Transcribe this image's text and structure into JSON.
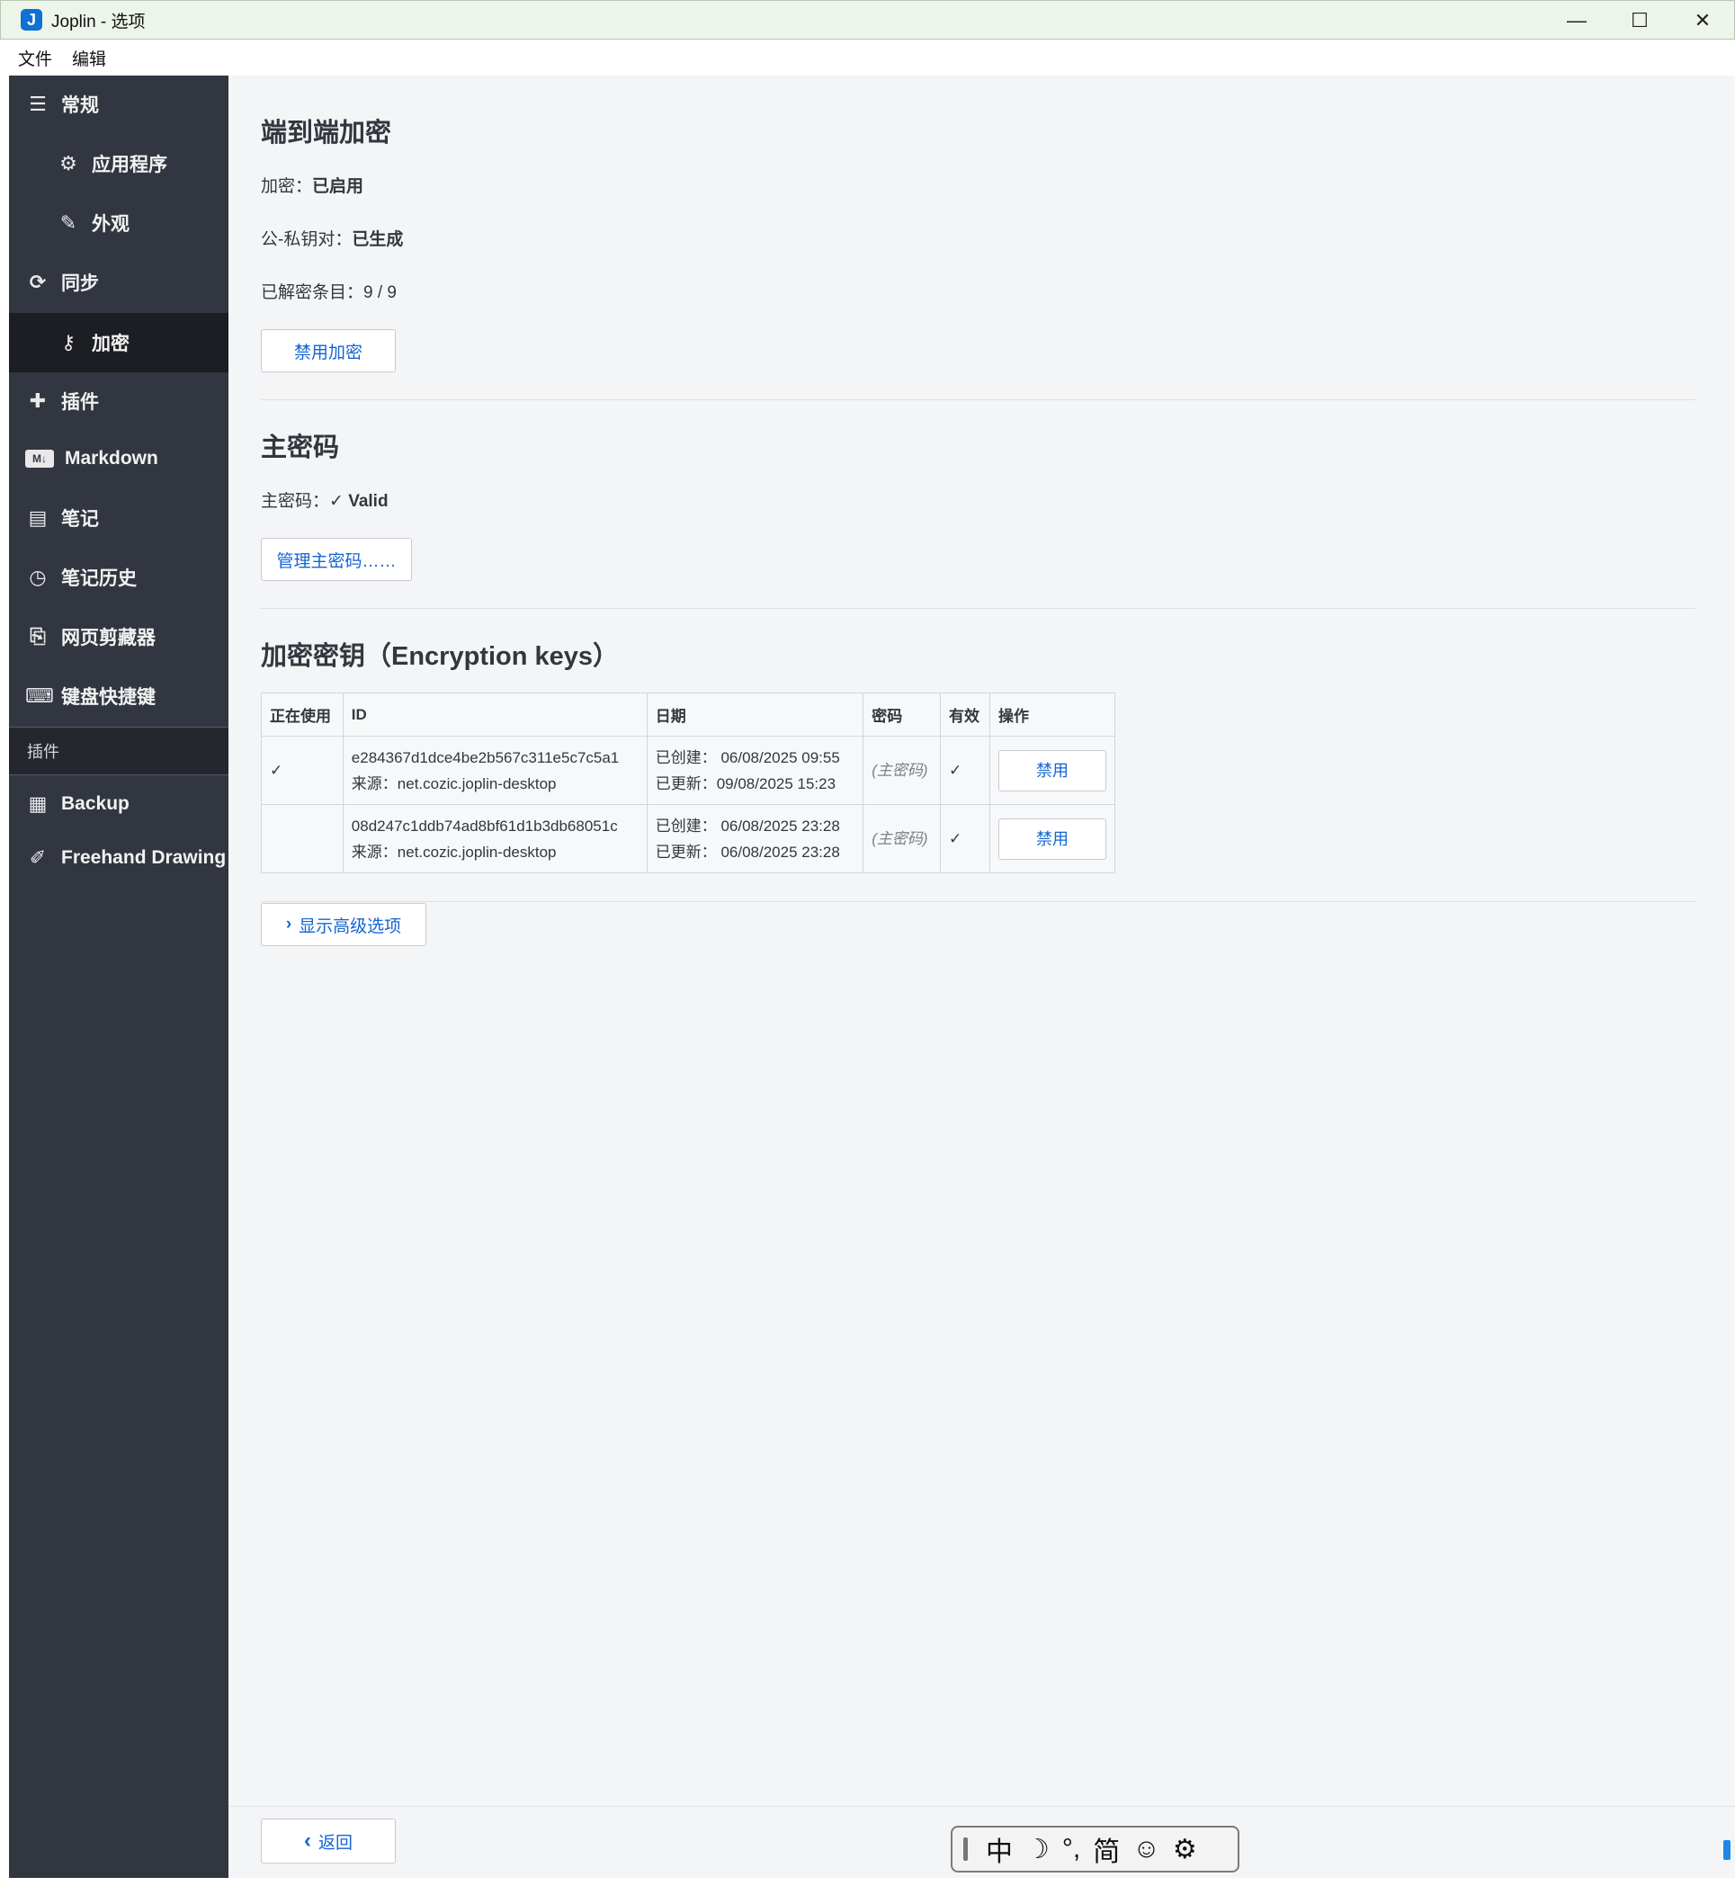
{
  "window": {
    "title": "Joplin - 选项",
    "minimize": "—",
    "maximize": "☐",
    "close": "✕"
  },
  "menu": [
    "文件",
    "编辑"
  ],
  "sidebar": {
    "items": [
      {
        "label": "常规",
        "icon": "sliders-icon"
      },
      {
        "label": "应用程序",
        "icon": "gear-icon"
      },
      {
        "label": "外观",
        "icon": "brush-icon"
      },
      {
        "label": "同步",
        "icon": "sync-icon"
      },
      {
        "label": "加密",
        "icon": "key-icon"
      },
      {
        "label": "插件",
        "icon": "puzzle-icon"
      },
      {
        "label": "Markdown",
        "icon": "markdown-icon"
      },
      {
        "label": "笔记",
        "icon": "note-icon"
      },
      {
        "label": "笔记历史",
        "icon": "history-icon"
      },
      {
        "label": "网页剪藏器",
        "icon": "clipper-icon"
      },
      {
        "label": "键盘快捷键",
        "icon": "keyboard-icon"
      }
    ],
    "section_label": "插件",
    "plugins": [
      {
        "label": "Backup",
        "icon": "archive-icon"
      },
      {
        "label": "Freehand Drawing",
        "icon": "pen-icon"
      }
    ]
  },
  "e2ee": {
    "title": "端到端加密",
    "encryption_label": "加密：",
    "encryption_value": "已启用",
    "keypair_label": "公-私钥对：",
    "keypair_value": "已生成",
    "decrypted_label": "已解密条目：",
    "decrypted_value": "9 / 9",
    "disable_button": "禁用加密"
  },
  "master_password": {
    "title": "主密码",
    "label": "主密码：",
    "value": "✓ Valid",
    "manage_button": "管理主密码……"
  },
  "keys": {
    "title": "加密密钥（Encryption keys）",
    "headers": [
      "正在使用",
      "ID",
      "日期",
      "密码",
      "有效",
      "操作"
    ],
    "rows": [
      {
        "in_use": "✓",
        "id": "e284367d1dce4be2b567c311e5c7c5a1",
        "source": "来源：net.cozic.joplin-desktop",
        "created": "已创建：  06/08/2025 09:55",
        "updated": "已更新：09/08/2025 15:23",
        "password": "(主密码)",
        "valid": "✓",
        "action": "禁用"
      },
      {
        "in_use": "",
        "id": "08d247c1ddb74ad8bf61d1b3db68051c",
        "source": "来源：net.cozic.joplin-desktop",
        "created": "已创建：  06/08/2025 23:28",
        "updated": "已更新：  06/08/2025 23:28",
        "password": "(主密码)",
        "valid": "✓",
        "action": "禁用"
      }
    ]
  },
  "advanced_button": "显示高级选项",
  "back_button": "返回",
  "ime": {
    "mode": "中",
    "moon": "☽",
    "punct": "°,",
    "script": "简",
    "emoji": "☺",
    "settings": "⚙"
  }
}
